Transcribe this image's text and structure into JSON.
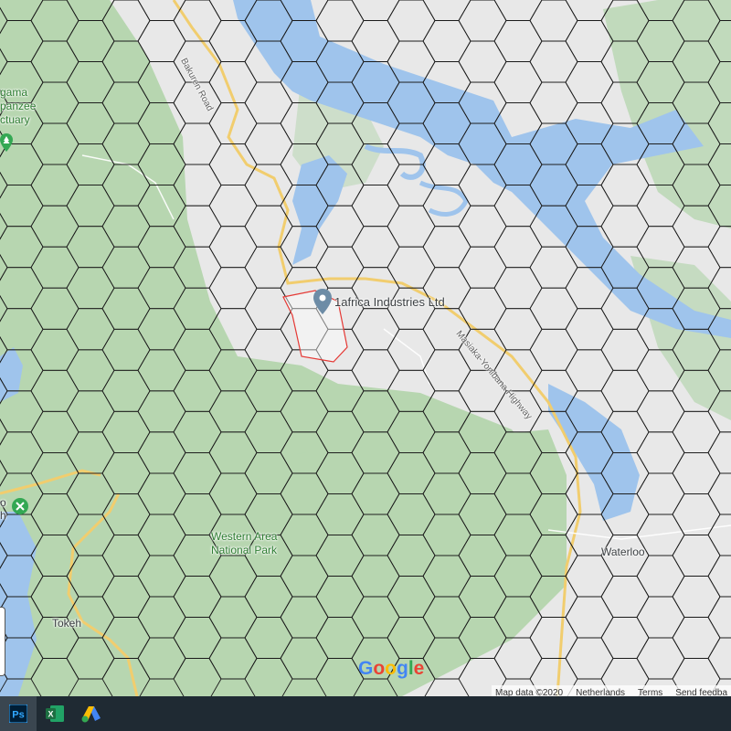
{
  "map": {
    "place_labels": {
      "sanctuary": [
        "gama",
        "panzee",
        "ctuary"
      ],
      "industry": "1africa Industries Ltd",
      "park": [
        "Western Area",
        "National Park"
      ],
      "waterloo": "Waterloo",
      "tokeh": "Tokeh",
      "left_fragment": [
        "o",
        "h"
      ]
    },
    "road_labels": {
      "north_road": "Bakuren Road",
      "highway": "Masiaka-Yonibana Highway"
    },
    "colors": {
      "land": "#e8e8e8",
      "park": "#b7d6b0",
      "water": "#9fc4ec",
      "road": "#f1cd6e",
      "hex_line": "#1a1a1a",
      "selection": "#e53935"
    },
    "logo": "Google",
    "attribution": [
      "Map data ©2020",
      "Netherlands",
      "Terms",
      "Send feedba"
    ]
  },
  "taskbar": {
    "apps": [
      {
        "name": "Ps",
        "color": "#31a8ff",
        "bg": "#001e36"
      },
      {
        "name": "X",
        "color": "#ffffff",
        "bg": "#1d6f42"
      },
      {
        "name": "ads",
        "color": "#fbbc04",
        "bg": "transparent"
      }
    ]
  }
}
